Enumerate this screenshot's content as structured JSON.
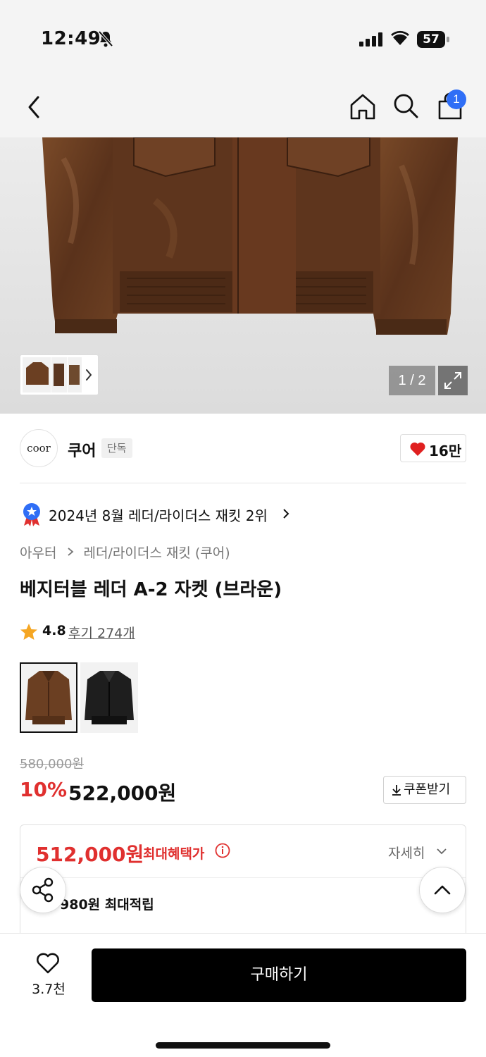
{
  "status_bar": {
    "time": "12:49",
    "battery": "57"
  },
  "header": {
    "cart_badge": "1"
  },
  "gallery": {
    "pager": "1 / 2"
  },
  "brand": {
    "logo_text": "coor",
    "name": "쿠어",
    "tag": "단독",
    "likes": "16만"
  },
  "ranking": {
    "text": "2024년 8월 레더/라이더스 재킷 2위"
  },
  "breadcrumb": {
    "level1": "아우터",
    "level2": "레더/라이더스 재킷 (쿠어)"
  },
  "product": {
    "title": "베지터블 레더 A-2 자켓 (브라운)"
  },
  "rating": {
    "score": "4.8",
    "reviews": "후기 274개"
  },
  "price": {
    "original": "580,000원",
    "discount": "10%",
    "sale": "522,000원",
    "coupon_label": "쿠폰받기"
  },
  "benefit": {
    "max_price": "512,000원",
    "max_label": "최대혜택가",
    "detail_label": "자세히",
    "points": "980원 최대적립"
  },
  "bottom_bar": {
    "wish_count": "3.7천",
    "buy_label": "구매하기"
  },
  "colors": {
    "accent_red": "#e0302f",
    "badge_blue": "#2f6ef6",
    "leather_brown": "#6b3f22"
  }
}
